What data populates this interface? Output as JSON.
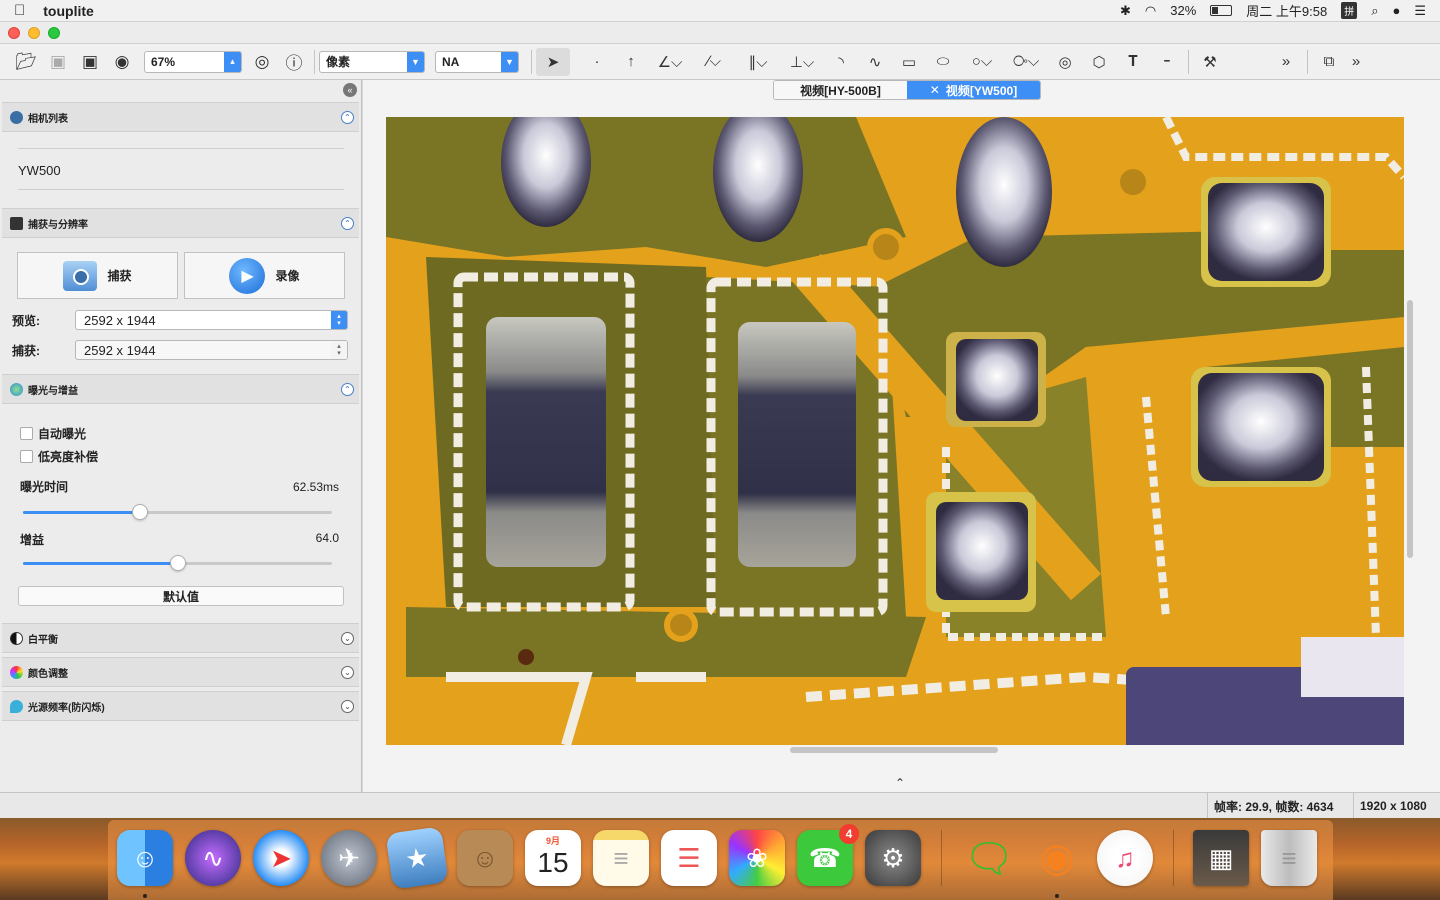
{
  "menubar": {
    "app_name": "touplite",
    "battery_percent": "32%",
    "clock": "周二 上午9:58",
    "ime": "拼"
  },
  "toolbar": {
    "zoom": "67%",
    "unit": "像素",
    "magnification": "NA"
  },
  "left_panel": {
    "camera_section": {
      "title": "相机列表",
      "camera_name": "YW500"
    },
    "capture_section": {
      "title": "捕获与分辨率",
      "capture_label": "捕获",
      "record_label": "录像",
      "preview_label": "预览:",
      "preview_value": "2592 x 1944",
      "still_label": "捕获:",
      "still_value": "2592 x 1944"
    },
    "exposure_section": {
      "title": "曝光与增益",
      "auto_exposure_label": "自动曝光",
      "low_light_label": "低亮度补偿",
      "exposure_time_label": "曝光时间",
      "exposure_time_value": "62.53ms",
      "exposure_slider_fraction": 0.38,
      "gain_label": "增益",
      "gain_value": "64.0",
      "gain_slider_fraction": 0.5,
      "default_label": "默认值"
    },
    "white_balance_title": "白平衡",
    "color_title": "颜色调整",
    "flicker_title": "光源频率(防闪烁)"
  },
  "tabs": [
    {
      "label": "视频[HY-500B]",
      "active": false
    },
    {
      "label": "视频[YW500]",
      "active": true
    }
  ],
  "statusbar": {
    "frame_info": "帧率: 29.9, 帧数: 4634",
    "resolution": "1920 x 1080"
  },
  "dock": {
    "calendar_month": "9月",
    "calendar_day": "15",
    "facetime_badge": "4"
  },
  "colors": {
    "accent": "#3d8ef5",
    "pcb_orange": "#e4a11b",
    "pcb_olive": "#7a7425",
    "silkscreen": "#f2ede2"
  }
}
